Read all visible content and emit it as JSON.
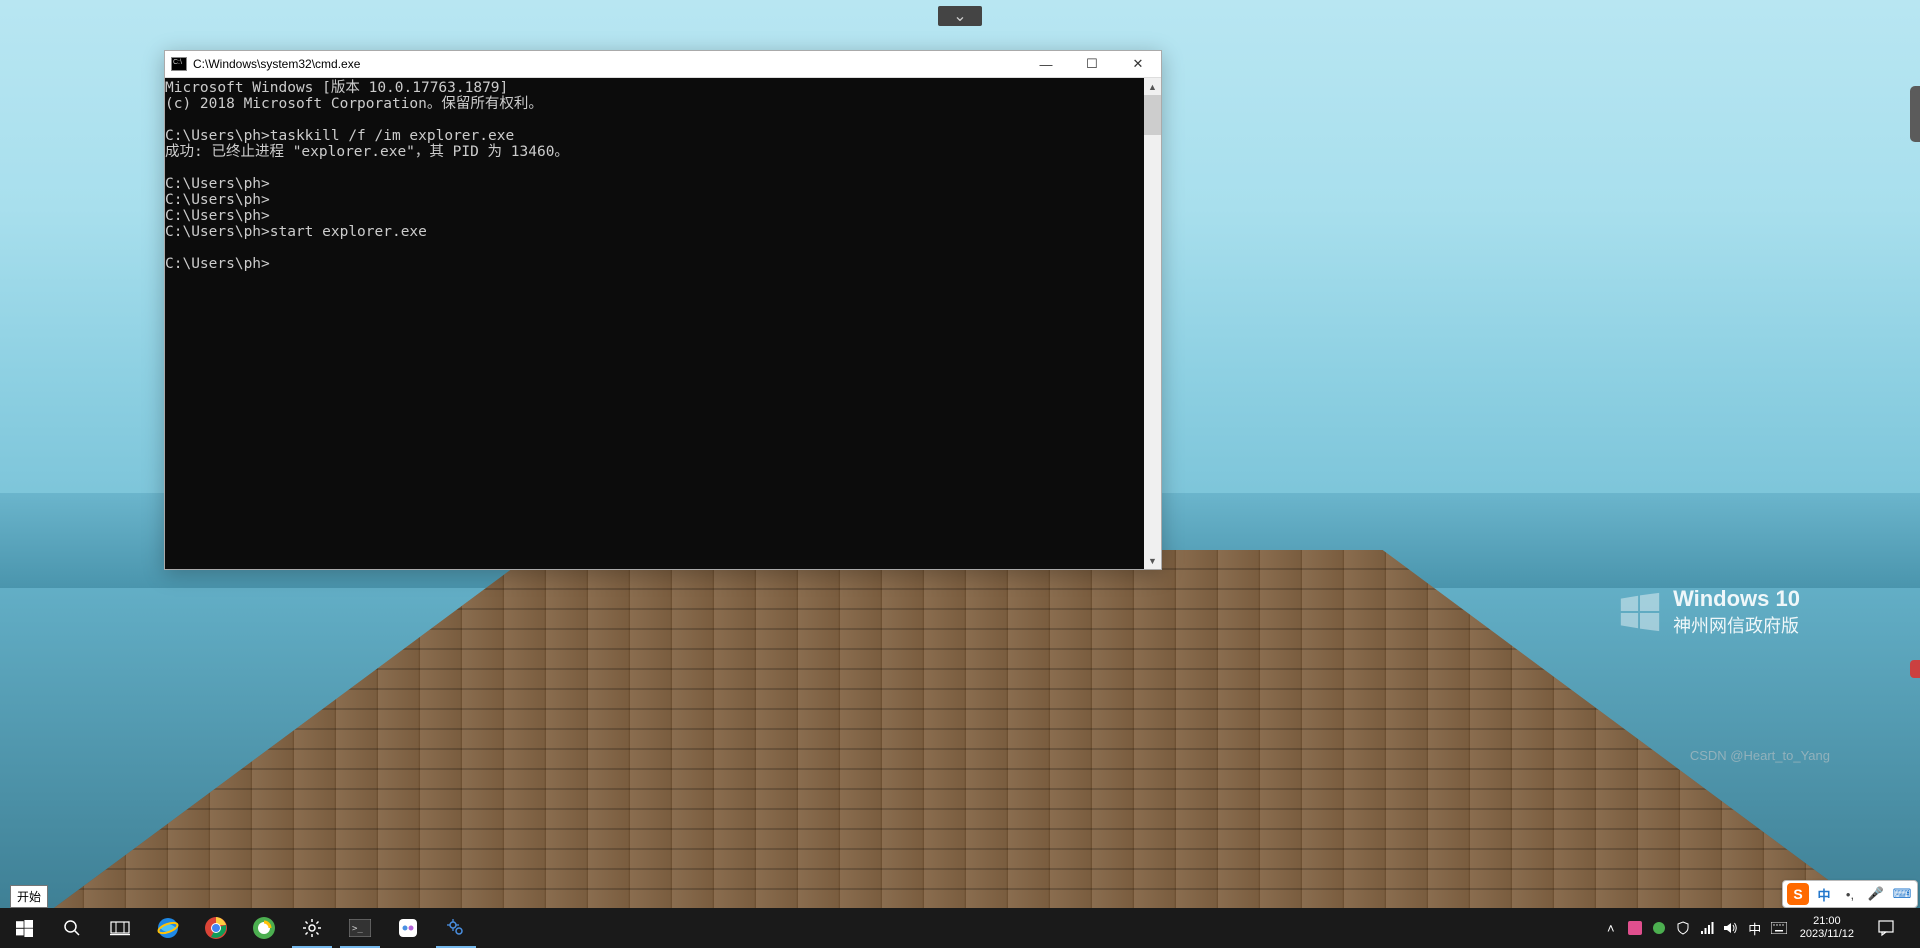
{
  "top_notch": {
    "glyph": "⌄"
  },
  "cmd": {
    "title": "C:\\Windows\\system32\\cmd.exe",
    "lines": [
      "Microsoft Windows [版本 10.0.17763.1879]",
      "(c) 2018 Microsoft Corporation。保留所有权利。",
      "",
      "C:\\Users\\ph>taskkill /f /im explorer.exe",
      "成功: 已终止进程 \"explorer.exe\"，其 PID 为 13460。",
      "",
      "C:\\Users\\ph>",
      "C:\\Users\\ph>",
      "C:\\Users\\ph>",
      "C:\\Users\\ph>start explorer.exe",
      "",
      "C:\\Users\\ph>"
    ],
    "controls": {
      "min": "—",
      "max": "☐",
      "close": "✕"
    }
  },
  "watermark": {
    "line1": "Windows 10",
    "line2": "神州网信政府版"
  },
  "csdn": "CSDN @Heart_to_Yang",
  "start_tooltip": "开始",
  "taskbar": {
    "items": [
      {
        "name": "start-button",
        "active": false
      },
      {
        "name": "search-button",
        "active": false
      },
      {
        "name": "taskview-button",
        "active": false
      },
      {
        "name": "ie-app",
        "active": false
      },
      {
        "name": "chrome-app",
        "active": false
      },
      {
        "name": "360-app",
        "active": false
      },
      {
        "name": "settings-app",
        "active": true
      },
      {
        "name": "cmd-app",
        "active": true
      },
      {
        "name": "qq-app",
        "active": false
      },
      {
        "name": "services-app",
        "active": true
      }
    ]
  },
  "tray": {
    "chevron": "˄",
    "ime_label": "中",
    "time": "21:00",
    "date": "2023/11/12"
  },
  "ime_bar": {
    "logo": "S",
    "items": [
      "中",
      "•,",
      "🎤",
      "⌨"
    ]
  }
}
